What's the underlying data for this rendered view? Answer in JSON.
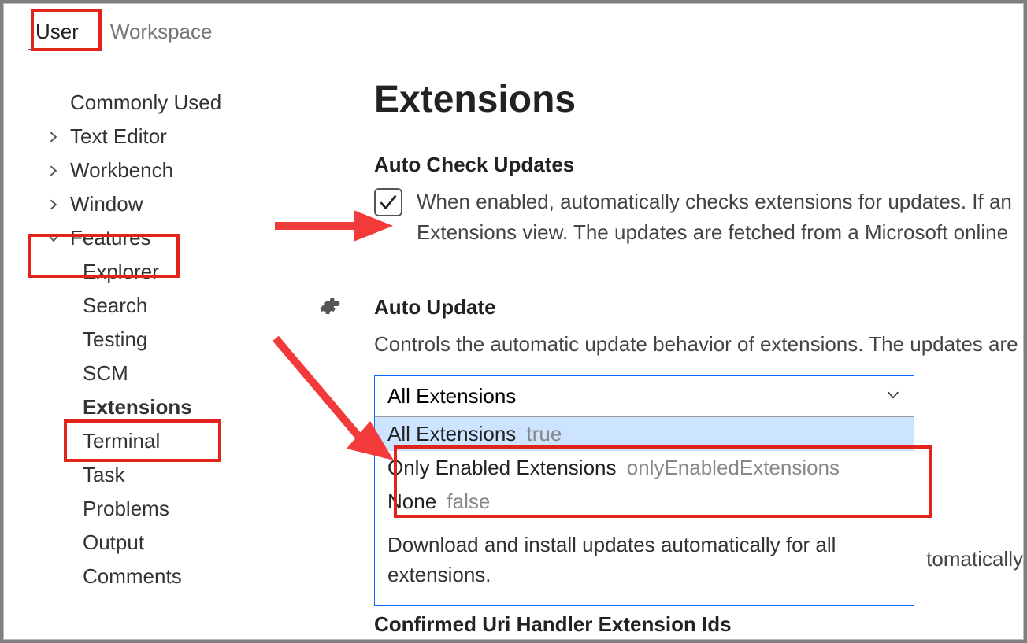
{
  "tabs": {
    "user": "User",
    "workspace": "Workspace"
  },
  "sidebar": {
    "commonly_used": "Commonly Used",
    "text_editor": "Text Editor",
    "workbench": "Workbench",
    "window": "Window",
    "features": "Features",
    "features_children": {
      "explorer": "Explorer",
      "search": "Search",
      "testing": "Testing",
      "scm": "SCM",
      "extensions": "Extensions",
      "terminal": "Terminal",
      "task": "Task",
      "problems": "Problems",
      "output": "Output",
      "comments": "Comments"
    }
  },
  "main": {
    "title": "Extensions",
    "auto_check_updates": {
      "label": "Auto Check Updates",
      "checked": true,
      "description": "When enabled, automatically checks extensions for updates. If an Extensions view. The updates are fetched from a Microsoft online"
    },
    "auto_update": {
      "label": "Auto Update",
      "description": "Controls the automatic update behavior of extensions. The updates are",
      "selected": "All Extensions",
      "options": [
        {
          "label": "All Extensions",
          "value": "true",
          "highlighted": true
        },
        {
          "label": "Only Enabled Extensions",
          "value": "onlyEnabledExtensions",
          "highlighted": false
        },
        {
          "label": "None",
          "value": "false",
          "highlighted": false
        }
      ],
      "option_description": "Download and install updates automatically for all extensions."
    },
    "truncated_right": "tomatically",
    "next_setting_partial": "Confirmed Uri Handler Extension Ids"
  }
}
